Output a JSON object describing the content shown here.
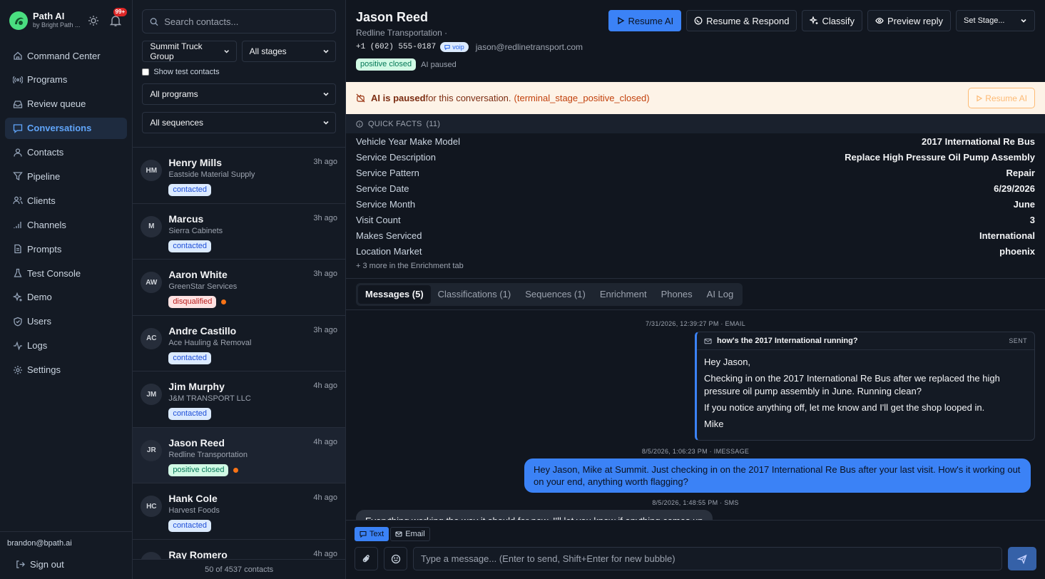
{
  "brand": {
    "name": "Path AI",
    "sub": "by Bright Path ...",
    "notif_count": "99+"
  },
  "nav": [
    {
      "label": "Command Center",
      "icon": "home-icon"
    },
    {
      "label": "Programs",
      "icon": "broadcast-icon"
    },
    {
      "label": "Review queue",
      "icon": "inbox-icon"
    },
    {
      "label": "Conversations",
      "icon": "chat-icon",
      "active": true
    },
    {
      "label": "Contacts",
      "icon": "user-icon"
    },
    {
      "label": "Pipeline",
      "icon": "funnel-icon"
    },
    {
      "label": "Clients",
      "icon": "users-icon"
    },
    {
      "label": "Channels",
      "icon": "signal-icon"
    },
    {
      "label": "Prompts",
      "icon": "document-icon"
    },
    {
      "label": "Test Console",
      "icon": "flask-icon"
    },
    {
      "label": "Demo",
      "icon": "sparkle-icon"
    },
    {
      "label": "Users",
      "icon": "shield-icon"
    },
    {
      "label": "Logs",
      "icon": "activity-icon"
    },
    {
      "label": "Settings",
      "icon": "gear-icon"
    }
  ],
  "user": {
    "email": "brandon@bpath.ai",
    "signout": "Sign out"
  },
  "filters": {
    "search_placeholder": "Search contacts...",
    "client": "Summit Truck Group",
    "stage": "All stages",
    "show_test": "Show test contacts",
    "program": "All programs",
    "sequence": "All sequences"
  },
  "contacts": [
    {
      "initials": "HM",
      "name": "Henry Mills",
      "company": "Eastside Material Supply",
      "tag": "contacted",
      "tag_type": "contacted",
      "time": "3h ago",
      "dot": false
    },
    {
      "initials": "M",
      "name": "Marcus",
      "company": "Sierra Cabinets",
      "tag": "contacted",
      "tag_type": "contacted",
      "time": "3h ago",
      "dot": false
    },
    {
      "initials": "AW",
      "name": "Aaron White",
      "company": "GreenStar Services",
      "tag": "disqualified",
      "tag_type": "disq",
      "time": "3h ago",
      "dot": true
    },
    {
      "initials": "AC",
      "name": "Andre Castillo",
      "company": "Ace Hauling & Removal",
      "tag": "contacted",
      "tag_type": "contacted",
      "time": "3h ago",
      "dot": false
    },
    {
      "initials": "JM",
      "name": "Jim Murphy",
      "company": "J&M TRANSPORT LLC",
      "tag": "contacted",
      "tag_type": "contacted",
      "time": "4h ago",
      "dot": false
    },
    {
      "initials": "JR",
      "name": "Jason Reed",
      "company": "Redline Transportation",
      "tag": "positive closed",
      "tag_type": "pos",
      "time": "4h ago",
      "dot": true,
      "selected": true
    },
    {
      "initials": "HC",
      "name": "Hank Cole",
      "company": "Harvest Foods",
      "tag": "contacted",
      "tag_type": "contacted",
      "time": "4h ago",
      "dot": false
    },
    {
      "initials": "RR",
      "name": "Ray Romero",
      "company": "",
      "tag": "",
      "tag_type": "",
      "time": "4h ago",
      "dot": false
    }
  ],
  "list_footer": "50 of 4537 contacts",
  "contact": {
    "name": "Jason Reed",
    "company": "Redline Transportation ·",
    "phone": "+1 (602) 555-0187",
    "phone_type": "voip",
    "email": "jason@redlinetransport.com",
    "stage_tag": "positive closed",
    "ai_status": "AI paused"
  },
  "actions": {
    "resume_ai": "Resume AI",
    "resume_respond": "Resume & Respond",
    "classify": "Classify",
    "preview": "Preview reply",
    "set_stage": "Set Stage..."
  },
  "banner": {
    "bold": "AI is paused",
    "text": " for this conversation.",
    "reason": "(terminal_stage_positive_closed)",
    "button": "Resume AI"
  },
  "quick_facts": {
    "title": "QUICK FACTS",
    "count": "(11)",
    "items": [
      {
        "key": "Vehicle Year Make Model",
        "value": "2017 International Re Bus"
      },
      {
        "key": "Service Description",
        "value": "Replace High Pressure Oil Pump Assembly"
      },
      {
        "key": "Service Pattern",
        "value": "Repair"
      },
      {
        "key": "Service Date",
        "value": "6/29/2026"
      },
      {
        "key": "Service Month",
        "value": "June"
      },
      {
        "key": "Visit Count",
        "value": "3"
      },
      {
        "key": "Makes Serviced",
        "value": "International"
      },
      {
        "key": "Location Market",
        "value": "phoenix"
      }
    ],
    "more": "+ 3 more in the Enrichment tab"
  },
  "tabs": [
    {
      "label": "Messages (5)",
      "active": true
    },
    {
      "label": "Classifications (1)"
    },
    {
      "label": "Sequences (1)"
    },
    {
      "label": "Enrichment"
    },
    {
      "label": "Phones"
    },
    {
      "label": "AI Log"
    }
  ],
  "messages": {
    "m1_meta": "7/31/2026, 12:39:27 PM · EMAIL",
    "m1_subject": "how's the 2017 International running?",
    "m1_status": "SENT",
    "m1_lines": [
      "Hey Jason,",
      "Checking in on the 2017 International Re Bus after we replaced the high pressure oil pump assembly in June. Running clean?",
      "If you notice anything off, let me know and I'll get the shop looped in.",
      "Mike"
    ],
    "m2_meta": "8/5/2026, 1:06:23 PM · IMESSAGE",
    "m2_text": "Hey Jason, Mike at Summit. Just checking in on the 2017 International Re Bus after your last visit. How's it working out on your end, anything worth flagging?",
    "m3_meta": "8/5/2026, 1:48:55 PM · SMS",
    "m3_text": "Everything working the way it should for now.  I'll let you know if anything comes up"
  },
  "composer": {
    "mode_text": "Text",
    "mode_email": "Email",
    "placeholder": "Type a message... (Enter to send, Shift+Enter for new bubble)"
  },
  "colors": {
    "accent": "#3b82f6",
    "banner_bg": "#fdf3e7",
    "notif": "#dc2626"
  }
}
